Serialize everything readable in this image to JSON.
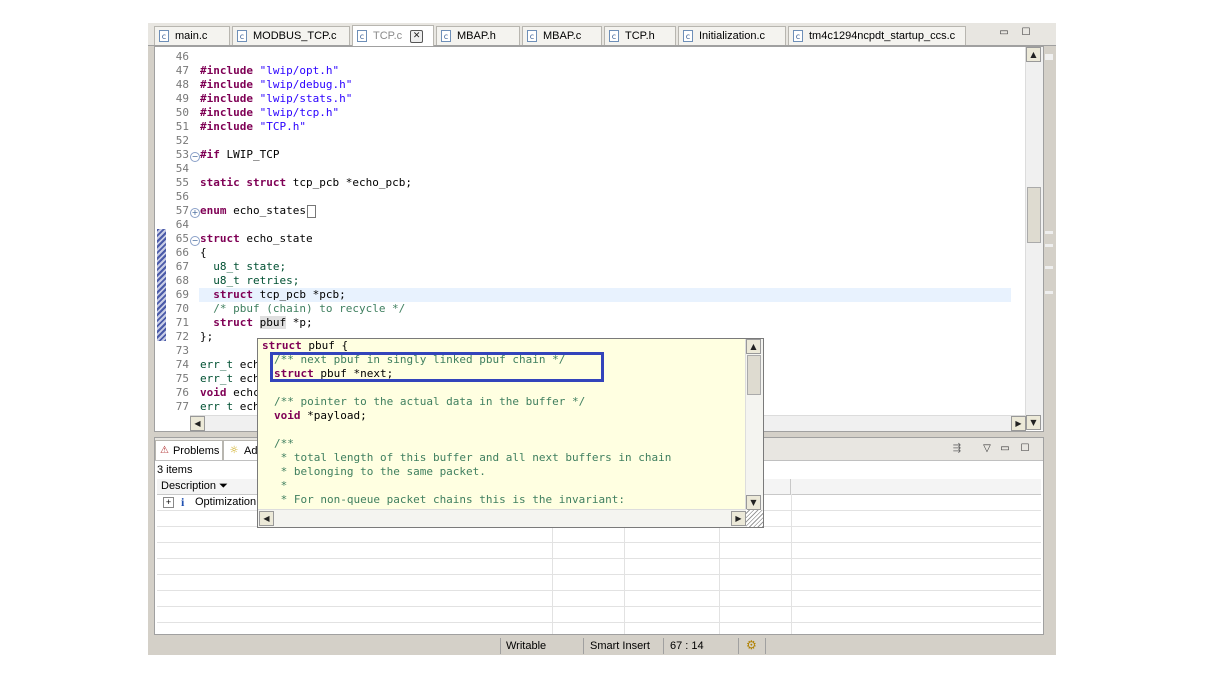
{
  "tabs": [
    {
      "label": "main.c",
      "active": false
    },
    {
      "label": "MODBUS_TCP.c",
      "active": false
    },
    {
      "label": "TCP.c",
      "active": true
    },
    {
      "label": "MBAP.h",
      "active": false
    },
    {
      "label": "MBAP.c",
      "active": false
    },
    {
      "label": "TCP.h",
      "active": false
    },
    {
      "label": "Initialization.c",
      "active": false
    },
    {
      "label": "tm4c1294ncpdt_startup_ccs.c",
      "active": false
    }
  ],
  "editor": {
    "line_numbers": [
      "46",
      "47",
      "48",
      "49",
      "50",
      "51",
      "52",
      "53",
      "54",
      "55",
      "56",
      "57",
      "64",
      "65",
      "66",
      "67",
      "68",
      "69",
      "70",
      "71",
      "72",
      "73",
      "74",
      "75",
      "76",
      "77"
    ],
    "code": {
      "inc_kw": "#include",
      "inc1": "\"lwip/opt.h\"",
      "inc2": "\"lwip/debug.h\"",
      "inc3": "\"lwip/stats.h\"",
      "inc4": "\"lwip/tcp.h\"",
      "inc5": "\"TCP.h\"",
      "if_kw": "#if",
      "if_rest": " LWIP_TCP",
      "static_kw": "static",
      "struct_kw": "struct",
      "tcp_pcb": " tcp_pcb ",
      "echo_pcb": "*echo_pcb;",
      "enum_kw": "enum",
      "echo_states": " echo_states",
      "echo_state": " echo_state",
      "brace_open": "{",
      "u8_t": "u8_t",
      "state": " state;",
      "retries": " retries;",
      "pcb_field": "*pcb;",
      "pbuf_comment": "/* pbuf (chain) to recycle */",
      "pbuf_type": "pbuf",
      "p_field": " *p;",
      "brace_close": "};",
      "err_t": "err_t ",
      "ech": "ech",
      "void_kw": "void",
      "echc": " echc",
      "err_t2": "err t ",
      "echo_cut": "ech"
    }
  },
  "popup": {
    "lines": [
      {
        "k": "struct",
        "t": " pbuf {"
      },
      {
        "c": "/** next pbuf in singly linked pbuf chain */"
      },
      {
        "k": "struct",
        "t": " pbuf *next;"
      },
      {
        "t": ""
      },
      {
        "c": "/** pointer to the actual data in the buffer */"
      },
      {
        "k": "void",
        "t": " *payload;"
      },
      {
        "t": ""
      },
      {
        "c": "/**"
      },
      {
        "c": " * total length of this buffer and all next buffers in chain"
      },
      {
        "c": " * belonging to the same packet."
      },
      {
        "c": " *"
      },
      {
        "c": " * For non-queue packet chains this is the invariant:"
      }
    ]
  },
  "panel": {
    "tab_problems": "Problems",
    "tab_advice": "Ad",
    "items_count": "3 items",
    "col_description": "Description",
    "row1": "Optimization ..."
  },
  "status": {
    "writable": "Writable",
    "insert_mode": "Smart Insert",
    "position": "67 : 14"
  },
  "icons": {
    "file": "c-file-icon",
    "close": "close-icon",
    "minimize": "minimize-icon",
    "maximize": "maximize-icon"
  }
}
